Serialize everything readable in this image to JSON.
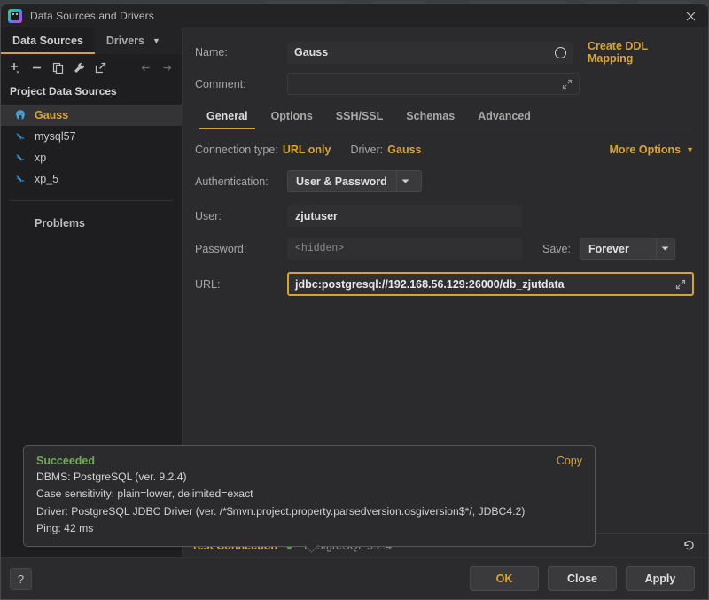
{
  "window": {
    "title": "Data Sources and Drivers",
    "app_icon": "datagrip-icon",
    "close_icon": "close-icon"
  },
  "sidebar": {
    "tabs": [
      {
        "label": "Data Sources",
        "active": true
      },
      {
        "label": "Drivers",
        "active": false
      }
    ],
    "drivers_caret": "chevron-down-icon",
    "toolbar": [
      {
        "name": "add-data-source-button",
        "icon": "plus-icon"
      },
      {
        "name": "remove-data-source-button",
        "icon": "minus-icon"
      },
      {
        "name": "duplicate-data-source-button",
        "icon": "copy-icon"
      },
      {
        "name": "properties-button",
        "icon": "wrench-icon"
      },
      {
        "name": "share-button",
        "icon": "external-link-icon"
      },
      {
        "name": "back-button",
        "icon": "arrow-left-icon"
      },
      {
        "name": "forward-button",
        "icon": "arrow-right-icon"
      }
    ],
    "group_header": "Project Data Sources",
    "items": [
      {
        "label": "Gauss",
        "icon": "postgres-elephant-icon",
        "selected": true
      },
      {
        "label": "mysql57",
        "icon": "mysql-dolphin-icon",
        "selected": false
      },
      {
        "label": "xp",
        "icon": "mysql-dolphin-icon",
        "selected": false
      },
      {
        "label": "xp_5",
        "icon": "mysql-dolphin-icon",
        "selected": false
      }
    ],
    "problems_label": "Problems"
  },
  "form": {
    "name_label": "Name:",
    "name_value": "Gauss",
    "name_ring_icon": "color-ring-icon",
    "comment_label": "Comment:",
    "comment_value": "",
    "comment_expand_icon": "expand-icon",
    "create_ddl_mapping": "Create DDL Mapping"
  },
  "tabs": [
    {
      "label": "General",
      "active": true
    },
    {
      "label": "Options",
      "active": false
    },
    {
      "label": "SSH/SSL",
      "active": false
    },
    {
      "label": "Schemas",
      "active": false
    },
    {
      "label": "Advanced",
      "active": false
    }
  ],
  "general": {
    "connection_type_label": "Connection type:",
    "connection_type_value": "URL only",
    "driver_label": "Driver:",
    "driver_value": "Gauss",
    "more_options": "More Options",
    "more_options_icon": "chevron-down-icon",
    "authentication_label": "Authentication:",
    "authentication_value": "User & Password",
    "auth_caret_icon": "caret-down-icon",
    "user_label": "User:",
    "user_value": "zjutuser",
    "password_label": "Password:",
    "password_placeholder": "<hidden>",
    "save_label": "Save:",
    "save_value": "Forever",
    "save_caret_icon": "caret-down-icon",
    "url_label": "URL:",
    "url_value": "jdbc:postgresql://192.168.56.129:26000/db_zjutdata",
    "url_expand_icon": "expand-icon"
  },
  "result": {
    "status": "Succeeded",
    "copy_label": "Copy",
    "lines": [
      "DBMS: PostgreSQL (ver. 9.2.4)",
      "Case sensitivity: plain=lower, delimited=exact",
      "Driver: PostgreSQL JDBC Driver (ver. /*$mvn.project.property.parsedversion.osgiversion$*/, JDBC4.2)",
      "Ping: 42 ms"
    ]
  },
  "test_strip": {
    "test_connection": "Test Connection",
    "check_icon": "check-icon",
    "version": "PostgreSQL 9.2.4",
    "reset_icon": "reset-arrow-icon"
  },
  "footer": {
    "help_label": "?",
    "ok_label": "OK",
    "close_label": "Close",
    "apply_label": "Apply"
  },
  "colors": {
    "accent_yellow": "#d8a33a",
    "success_green": "#6fae52",
    "dialog_bg": "#2b2b2d",
    "sidebar_bg": "#1e1e20"
  }
}
